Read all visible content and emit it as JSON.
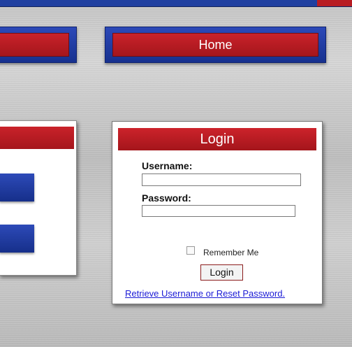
{
  "nav": {
    "prev_label": "",
    "home_label": "Home"
  },
  "login": {
    "title": "Login",
    "username_label": "Username:",
    "username_value": "",
    "password_label": "Password:",
    "password_value": "",
    "remember_label": "Remember Me",
    "remember_checked": false,
    "submit_label": "Login",
    "reset_link": "Retrieve Username or Reset Password."
  },
  "colors": {
    "brand_red": "#b81c22",
    "brand_blue": "#1f3fa0",
    "link_blue": "#1b1bd6"
  }
}
